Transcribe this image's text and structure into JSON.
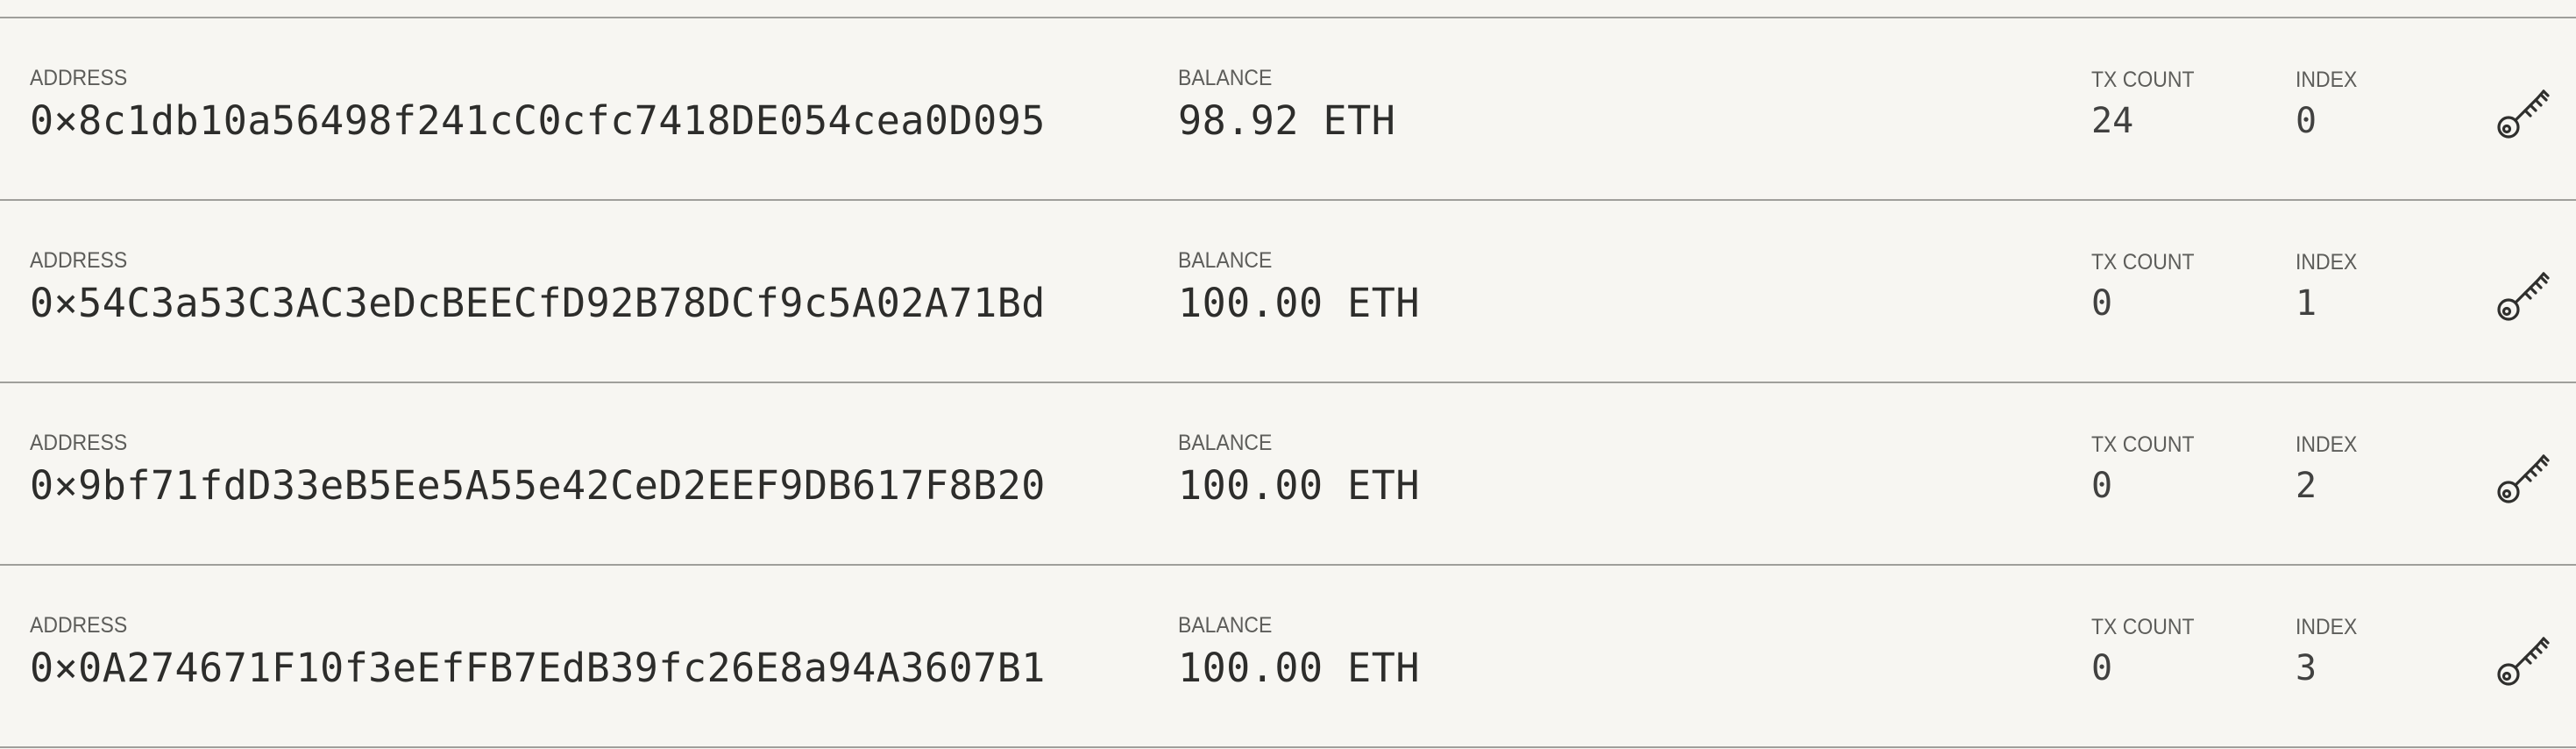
{
  "labels": {
    "address": "ADDRESS",
    "balance": "BALANCE",
    "tx_count": "TX COUNT",
    "index": "INDEX"
  },
  "accounts": [
    {
      "address": "0×8c1db10a56498f241cC0cfc7418DE054cea0D095",
      "balance": "98.92 ETH",
      "tx_count": "24",
      "index": "0",
      "action_icon": "key-icon"
    },
    {
      "address": "0×54C3a53C3AC3eDcBEECfD92B78DCf9c5A02A71Bd",
      "balance": "100.00 ETH",
      "tx_count": "0",
      "index": "1",
      "action_icon": "key-icon"
    },
    {
      "address": "0×9bf71fdD33eB5Ee5A55e42CeD2EEF9DB617F8B20",
      "balance": "100.00 ETH",
      "tx_count": "0",
      "index": "2",
      "action_icon": "key-icon"
    },
    {
      "address": "0×0A274671F10f3eEfFB7EdB39fc26E8a94A3607B1",
      "balance": "100.00 ETH",
      "tx_count": "0",
      "index": "3",
      "action_icon": "key-icon"
    }
  ],
  "colors": {
    "background": "#f7f6f2",
    "divider": "#9f9f9b",
    "label_text": "#5d5d5a",
    "value_text": "#2d2d2b"
  }
}
